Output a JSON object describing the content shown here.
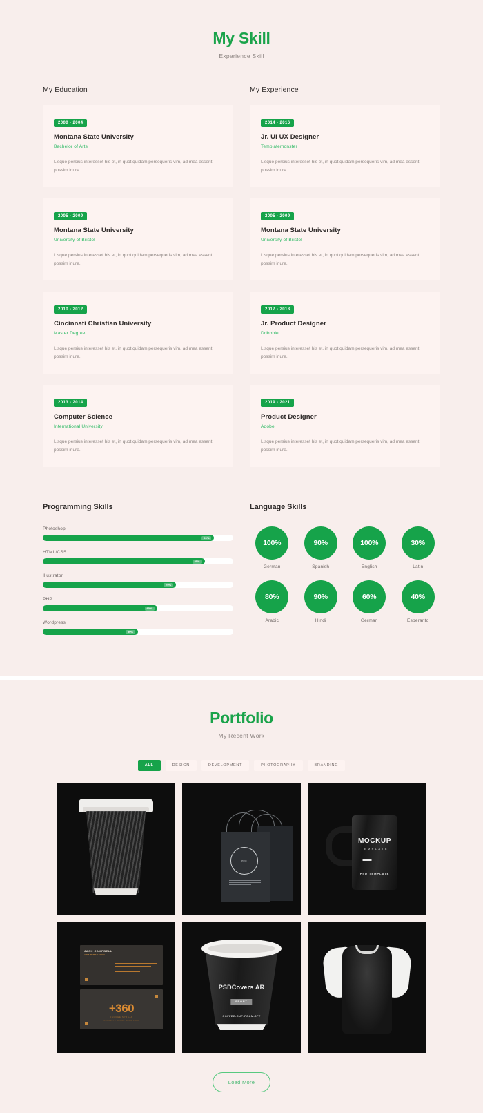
{
  "colors": {
    "accent": "#16a34a",
    "accent_light": "#2ab862",
    "page_bg": "#f8eeec",
    "card_bg": "#fdf3f1",
    "heading": "#2f2b2a",
    "muted": "#8d8582"
  },
  "skill_section": {
    "title": "My Skill",
    "subtitle": "Experience Skill",
    "education": {
      "heading": "My Education",
      "items": [
        {
          "date": "2000 - 2004",
          "title": "Montana State University",
          "org": "Bachelor of Arts",
          "desc": "Lisque persius interesset his et, in quot quidam persequeris vim, ad mea essent possim iriure."
        },
        {
          "date": "2005 - 2009",
          "title": "Montana State University",
          "org": "University of Bristol",
          "desc": "Lisque persius interesset his et, in quot quidam persequeris vim, ad mea essent possim iriure."
        },
        {
          "date": "2010 - 2012",
          "title": "Cincinnati Christian University",
          "org": "Master Degree",
          "desc": "Lisque persius interesset his et, in quot quidam persequeris vim, ad mea essent possim iriure."
        },
        {
          "date": "2013 - 2014",
          "title": "Computer Science",
          "org": "International University",
          "desc": "Lisque persius interesset his et, in quot quidam persequeris vim, ad mea essent possim iriure."
        }
      ]
    },
    "experience": {
      "heading": "My Experience",
      "items": [
        {
          "date": "2014 - 2016",
          "title": "Jr. UI UX Designer",
          "org": "Templatemonster",
          "desc": "Lisque persius interesset his et, in quot quidam persequeris vim, ad mea essent possim iriure."
        },
        {
          "date": "2005 - 2009",
          "title": "Montana State University",
          "org": "University of Bristol",
          "desc": "Lisque persius interesset his et, in quot quidam persequeris vim, ad mea essent possim iriure."
        },
        {
          "date": "2017 - 2018",
          "title": "Jr. Product Designer",
          "org": "Dribbble",
          "desc": "Lisque persius interesset his et, in quot quidam persequeris vim, ad mea essent possim iriure."
        },
        {
          "date": "2019 - 2021",
          "title": "Product Designer",
          "org": "Adobe",
          "desc": "Lisque persius interesset his et, in quot quidam persequeris vim, ad mea essent possim iriure."
        }
      ]
    },
    "programming_skills": {
      "heading": "Programming Skills",
      "items": [
        {
          "label": "Photoshop",
          "percent": 90,
          "percent_label": "90%"
        },
        {
          "label": "HTML/CSS",
          "percent": 85,
          "percent_label": "85%"
        },
        {
          "label": "Illustrator",
          "percent": 70,
          "percent_label": "70%"
        },
        {
          "label": "PHP",
          "percent": 60,
          "percent_label": "60%"
        },
        {
          "label": "Wordpress",
          "percent": 50,
          "percent_label": "50%"
        }
      ]
    },
    "language_skills": {
      "heading": "Language Skills",
      "items": [
        {
          "value": "100%",
          "name": "German"
        },
        {
          "value": "90%",
          "name": "Spanish"
        },
        {
          "value": "100%",
          "name": "English"
        },
        {
          "value": "30%",
          "name": "Latin"
        },
        {
          "value": "80%",
          "name": "Arabic"
        },
        {
          "value": "90%",
          "name": "Hindi"
        },
        {
          "value": "60%",
          "name": "German"
        },
        {
          "value": "40%",
          "name": "Esperanto"
        }
      ]
    }
  },
  "portfolio_section": {
    "title": "Portfolio",
    "subtitle": "My Recent Work",
    "filters": [
      {
        "label": "ALL",
        "active": true
      },
      {
        "label": "DESIGN",
        "active": false
      },
      {
        "label": "DEVELOPMENT",
        "active": false
      },
      {
        "label": "PHOTOGRAPHY",
        "active": false
      },
      {
        "label": "BRANDING",
        "active": false
      }
    ],
    "items": [
      {
        "name": "ripple-coffee-cup-mockup"
      },
      {
        "name": "shopping-bag-mockup",
        "ring_text": "PRO"
      },
      {
        "name": "mug-mockup",
        "title": "MOCKUP",
        "subtitle": "TEMPLATE",
        "footer": "PSD TEMPLATE"
      },
      {
        "name": "business-card-mockup",
        "card_name": "JACK CAMPBELL",
        "card_role": "ART DIRECTION",
        "big_text": "+360",
        "sup": "°",
        "sub": "DEGREE SPREAD",
        "sub2": "COMPLETE SOCIAL MEDIA PACK"
      },
      {
        "name": "foam-cup-mockup",
        "brand": "PSDCovers AR",
        "badge": "FRONT",
        "code": "COFFEE-CUP-FOAM-8FT"
      },
      {
        "name": "tshirt-mockup"
      }
    ],
    "load_more_label": "Load More"
  }
}
